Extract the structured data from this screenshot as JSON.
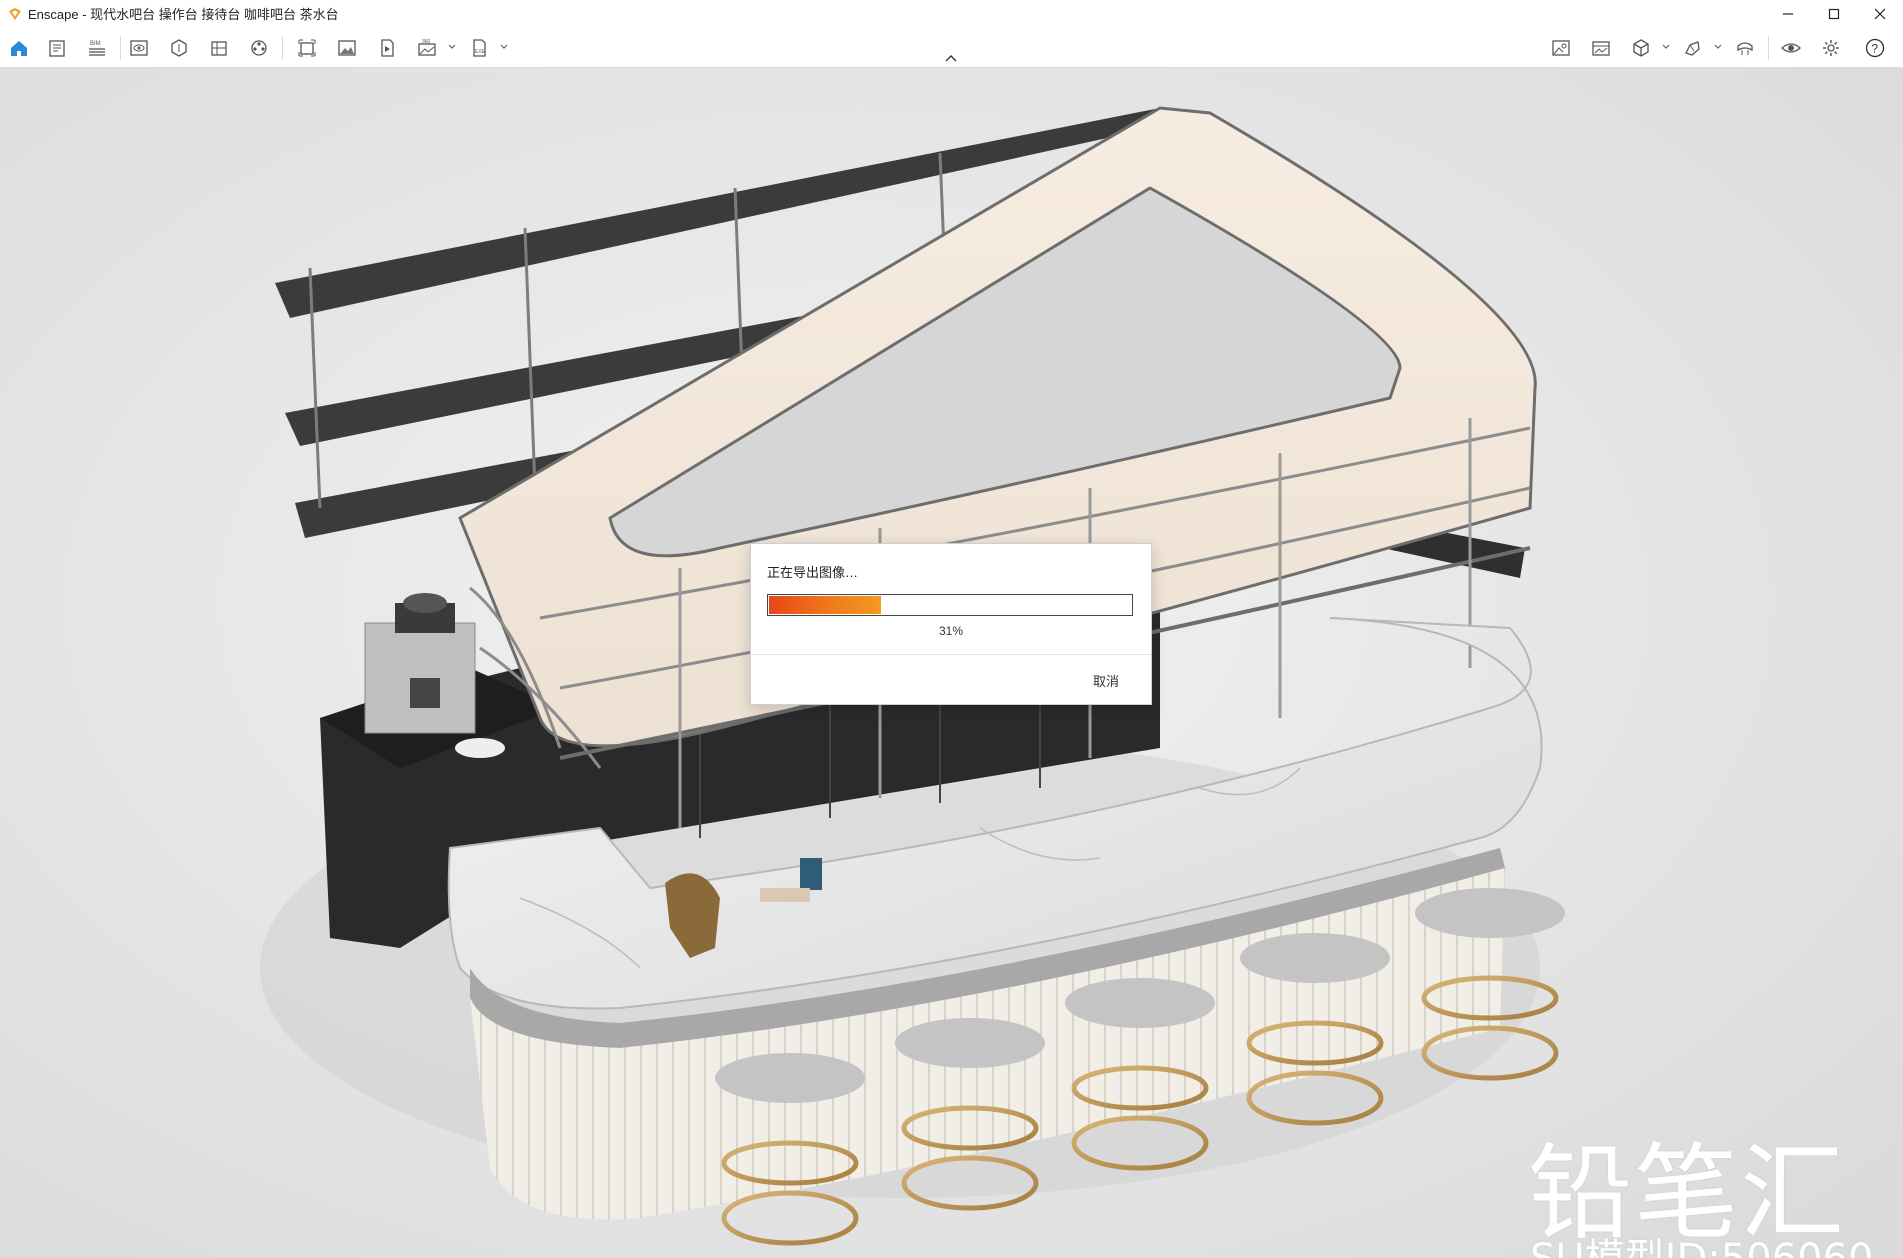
{
  "window": {
    "title": "Enscape - 现代水吧台 操作台 接待台 咖啡吧台 茶水台",
    "app_icon": "enscape-logo-icon",
    "accent": "#f2a11c"
  },
  "toolbar": {
    "left_icons": [
      "home-icon",
      "project-settings-icon",
      "bim-icon",
      "visual-settings-icon",
      "views-icon",
      "materials-icon",
      "assets-icon",
      "batch-render-icon",
      "screenshot-icon",
      "video-icon",
      "panorama-icon",
      "exe-export-icon"
    ],
    "bim_label": "BIM",
    "right_icons": [
      "image-compare-icon",
      "image-gallery-icon",
      "cube-view-icon",
      "annotations-icon",
      "vr-icon",
      "visibility-icon",
      "settings-icon",
      "help-icon"
    ],
    "home_active_color": "#2a8ad8"
  },
  "dialog": {
    "title": "正在导出图像…",
    "progress": 0.31,
    "progress_text": "31%",
    "cancel_label": "取消"
  },
  "watermark": {
    "brand": "铅笔汇",
    "model_id": "SU模型ID:506060"
  }
}
